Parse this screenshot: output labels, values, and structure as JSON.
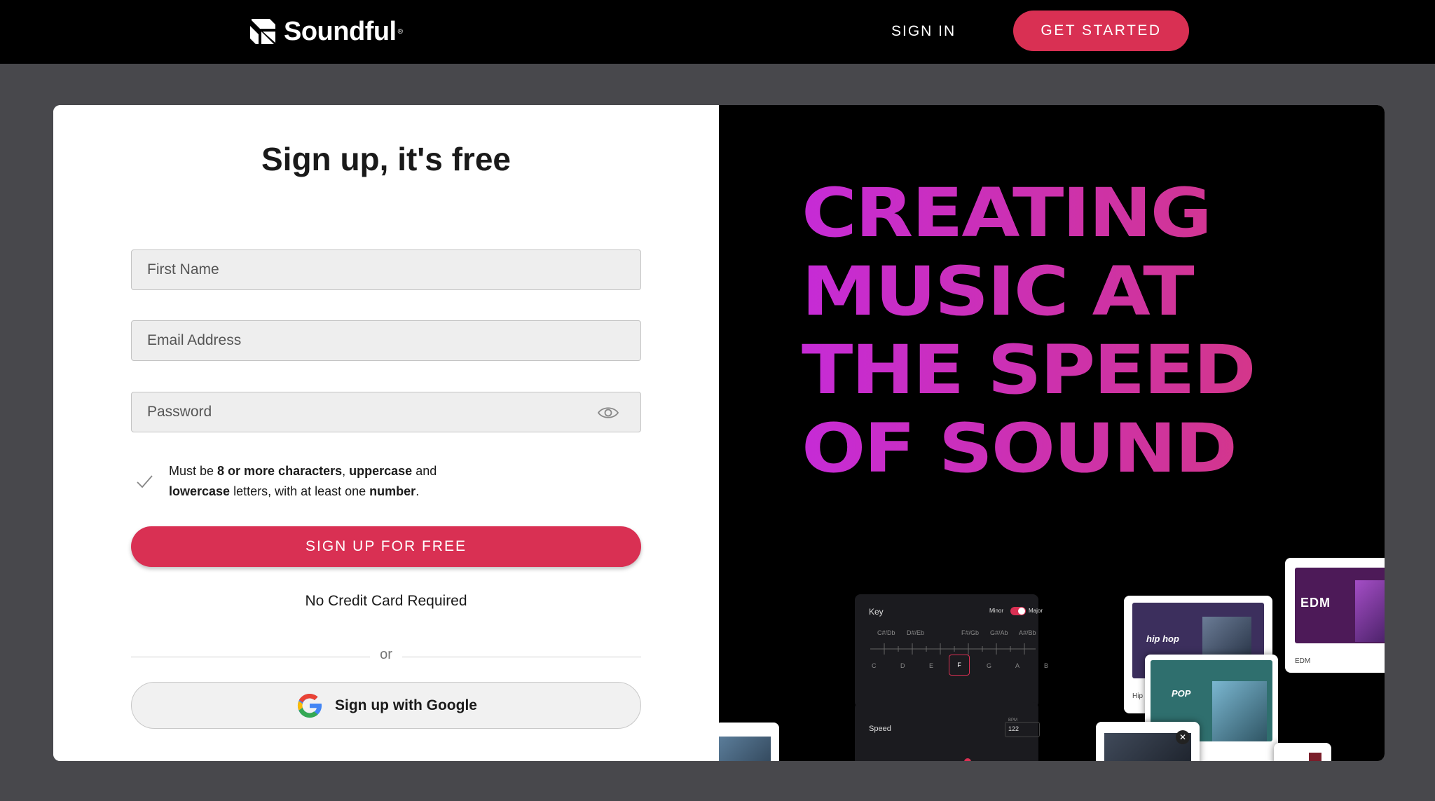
{
  "header": {
    "brand": "Soundful",
    "signin_label": "SIGN IN",
    "get_started_label": "GET STARTED"
  },
  "form": {
    "title": "Sign up, it's free",
    "first_name_placeholder": "First Name",
    "email_placeholder": "Email Address",
    "password_placeholder": "Password",
    "hint": {
      "p1": "Must be ",
      "b1": "8 or more characters",
      "p2": ", ",
      "b2": "uppercase",
      "p3": " and ",
      "b3": "lowercase",
      "p4": " letters, with at least one ",
      "b4": "number",
      "p5": "."
    },
    "signup_label": "SIGN UP FOR FREE",
    "no_credit_card": "No Credit Card Required",
    "or_label": "or",
    "google_label": "Sign up with Google"
  },
  "hero": {
    "line1": "CREATING",
    "line2": "MUSIC AT",
    "line3": "THE SPEED",
    "line4": "OF SOUND"
  },
  "mockup": {
    "key_label": "Key",
    "minor_label": "Minor",
    "major_label": "Major",
    "sharps": [
      "C#/Db",
      "D#/Eb",
      "F#/Gb",
      "G#/Ab",
      "A#/Bb"
    ],
    "notes": [
      "C",
      "D",
      "E",
      "F",
      "G",
      "A",
      "B"
    ],
    "selected_note": "F",
    "speed_label": "Speed",
    "bpm_label": "BPM",
    "bpm_value": "122",
    "genres": {
      "hiphop_art": "hip hop",
      "hiphop_label": "Hip Hop",
      "pop_art": "POP",
      "edm_art": "EDM",
      "edm_label": "EDM"
    }
  },
  "colors": {
    "accent": "#d93053",
    "page_bg": "#48484c",
    "headline_start": "#c62bd6",
    "headline_end": "#db3a6c"
  }
}
